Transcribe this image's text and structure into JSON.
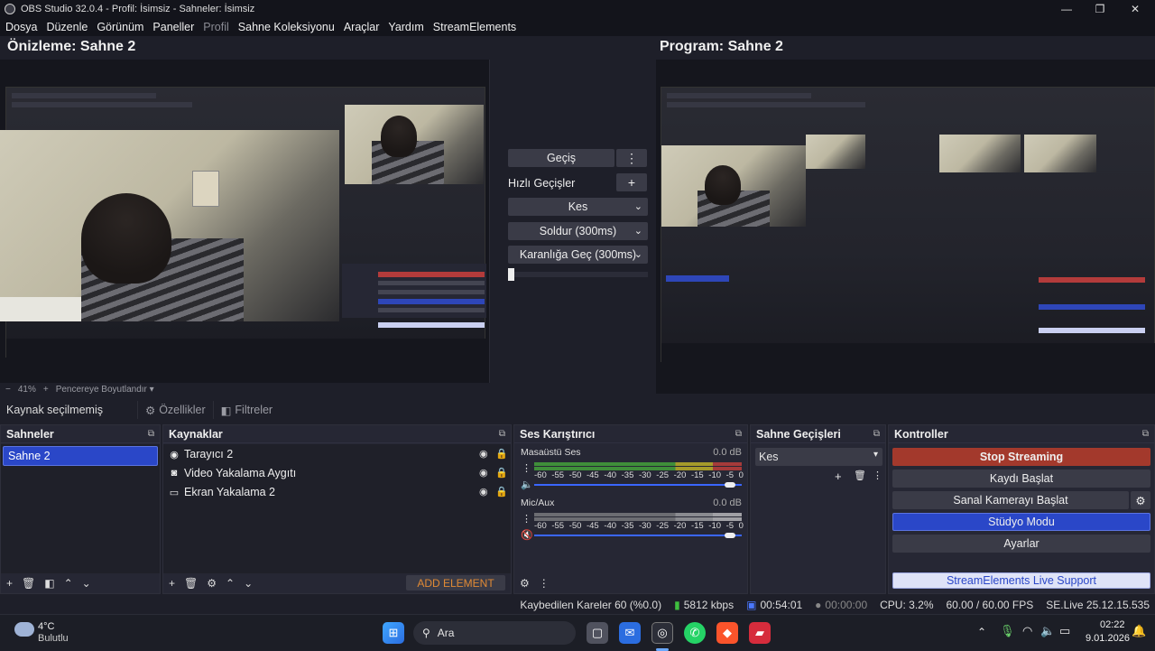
{
  "window": {
    "title": "OBS Studio 32.0.4 - Profil: İsimsiz - Sahneler: İsimsiz",
    "min": "—",
    "max": "❐",
    "close": "✕"
  },
  "menu": [
    "Dosya",
    "Düzenle",
    "Görünüm",
    "Paneller",
    "Profil",
    "Sahne Koleksiyonu",
    "Araçlar",
    "Yardım",
    "StreamElements"
  ],
  "preview": {
    "title": "Önizleme: Sahne 2",
    "zoom": "41%",
    "zoom_minus": "−",
    "zoom_plus": "+",
    "fit": "Pencereye Boyutlandır"
  },
  "program": {
    "title": "Program: Sahne 2"
  },
  "transitions": {
    "gecis": "Geçiş",
    "quick_label": "Hızlı Geçişler",
    "items": [
      "Kes",
      "Soldur (300ms)",
      "Karanlığa Geç (300ms)"
    ]
  },
  "source_toolbar": {
    "no_selection": "Kaynak seçilmemiş",
    "properties": "Özellikler",
    "filters": "Filtreler"
  },
  "scenes": {
    "title": "Sahneler",
    "items": [
      "Sahne 2"
    ]
  },
  "sources": {
    "title": "Kaynaklar",
    "items": [
      "Tarayıcı 2",
      "Video Yakalama Aygıtı",
      "Ekran Yakalama 2"
    ],
    "add_element": "ADD ELEMENT"
  },
  "mixer": {
    "title": "Ses Karıştırıcı",
    "channels": [
      {
        "name": "Masaüstü Ses",
        "db": "0.0 dB",
        "level": 0.97,
        "muted": false
      },
      {
        "name": "Mic/Aux",
        "db": "0.0 dB",
        "level": 0.97,
        "muted": true
      }
    ],
    "ticks": [
      "-60",
      "-55",
      "-50",
      "-45",
      "-40",
      "-35",
      "-30",
      "-25",
      "-20",
      "-15",
      "-10",
      "-5",
      "0"
    ]
  },
  "scene_transitions": {
    "title": "Sahne Geçişleri",
    "selected": "Kes"
  },
  "controls": {
    "title": "Kontroller",
    "stop_streaming": "Stop Streaming",
    "record": "Kaydı Başlat",
    "virtual_cam": "Sanal Kamerayı Başlat",
    "studio_mode": "Stüdyo Modu",
    "settings": "Ayarlar",
    "support": "StreamElements Live Support"
  },
  "status": {
    "dropped": "Kaybedilen Kareler 60 (%0.0)",
    "bitrate": "5812 kbps",
    "stream_time": "00:54:01",
    "rec_time": "00:00:00",
    "cpu": "CPU: 3.2%",
    "fps": "60.00 / 60.00 FPS",
    "version": "SE.Live 25.12.15.535"
  },
  "taskbar": {
    "weather_temp": "4°C",
    "weather_desc": "Bulutlu",
    "search": "Ara",
    "time": "02:22",
    "date": "9.01.2026"
  },
  "colors": {
    "accent_blue": "#2a47c8",
    "stop_red": "#a3392c",
    "bg": "#1e1f29"
  }
}
